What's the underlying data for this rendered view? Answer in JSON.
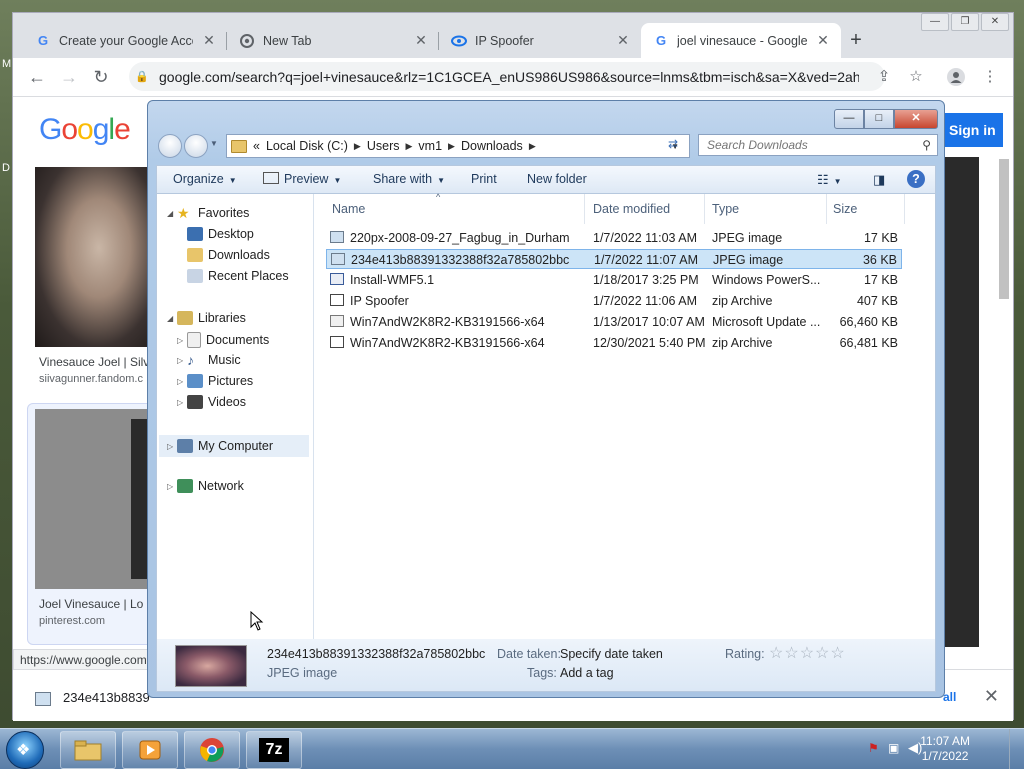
{
  "desktop": {
    "label_m": "M",
    "label_d": "D"
  },
  "chrome": {
    "tabs": [
      {
        "title": "Create your Google Accou",
        "icon": "google-icon"
      },
      {
        "title": "New Tab",
        "icon": "chrome-icon"
      },
      {
        "title": "IP Spoofer",
        "icon": "spoofer-icon"
      },
      {
        "title": "joel vinesauce - Google S",
        "icon": "google-icon"
      }
    ],
    "close_glyph": "✕",
    "new_tab_glyph": "+",
    "url": "google.com/search?q=joel+vinesauce&rlz=1C1GCEA_enUS986US986&source=lnms&tbm=isch&sa=X&ved=2ah...",
    "status_url": "https://www.google.com",
    "download_name": "234e413b8839",
    "page": {
      "logo": "Google",
      "signin": "Sign in",
      "result1_caption": "Vinesauce Joel | Silv",
      "result1_source": "siivagunner.fandom.c",
      "result2_caption": "Joel Vinesauce | Lo",
      "result2_source": "pinterest.com",
      "show_all": "all"
    }
  },
  "explorer": {
    "address": {
      "prefix": "«",
      "crumbs": [
        "Local Disk (C:)",
        "Users",
        "vm1",
        "Downloads"
      ]
    },
    "search_placeholder": "Search Downloads",
    "commands": {
      "organize": "Organize",
      "preview": "Preview",
      "share": "Share with",
      "print": "Print",
      "newfolder": "New folder"
    },
    "nav": {
      "favorites": "Favorites",
      "desktop": "Desktop",
      "downloads": "Downloads",
      "recent": "Recent Places",
      "libraries": "Libraries",
      "documents": "Documents",
      "music": "Music",
      "pictures": "Pictures",
      "videos": "Videos",
      "computer": "My Computer",
      "network": "Network"
    },
    "columns": {
      "name": "Name",
      "date": "Date modified",
      "type": "Type",
      "size": "Size"
    },
    "files": [
      {
        "name": "220px-2008-09-27_Fagbug_in_Durham",
        "date": "1/7/2022 11:03 AM",
        "type": "JPEG image",
        "size": "17 KB"
      },
      {
        "name": "234e413b88391332388f32a785802bbc",
        "date": "1/7/2022 11:07 AM",
        "type": "JPEG image",
        "size": "36 KB"
      },
      {
        "name": "Install-WMF5.1",
        "date": "1/18/2017 3:25 PM",
        "type": "Windows PowerS...",
        "size": "17 KB"
      },
      {
        "name": "IP Spoofer",
        "date": "1/7/2022 11:06 AM",
        "type": "zip Archive",
        "size": "407 KB"
      },
      {
        "name": "Win7AndW2K8R2-KB3191566-x64",
        "date": "1/13/2017 10:07 AM",
        "type": "Microsoft Update ...",
        "size": "66,460 KB"
      },
      {
        "name": "Win7AndW2K8R2-KB3191566-x64",
        "date": "12/30/2021 5:40 PM",
        "type": "zip Archive",
        "size": "66,481 KB"
      }
    ],
    "details": {
      "name": "234e413b88391332388f32a785802bbc",
      "type": "JPEG image",
      "date_label": "Date taken:",
      "date_value": "Specify date taken",
      "tags_label": "Tags:",
      "tags_value": "Add a tag",
      "rating_label": "Rating:",
      "stars": "☆☆☆☆☆"
    }
  },
  "taskbar": {
    "time": "11:07 AM",
    "date": "1/7/2022",
    "sevenzip": "7z"
  }
}
